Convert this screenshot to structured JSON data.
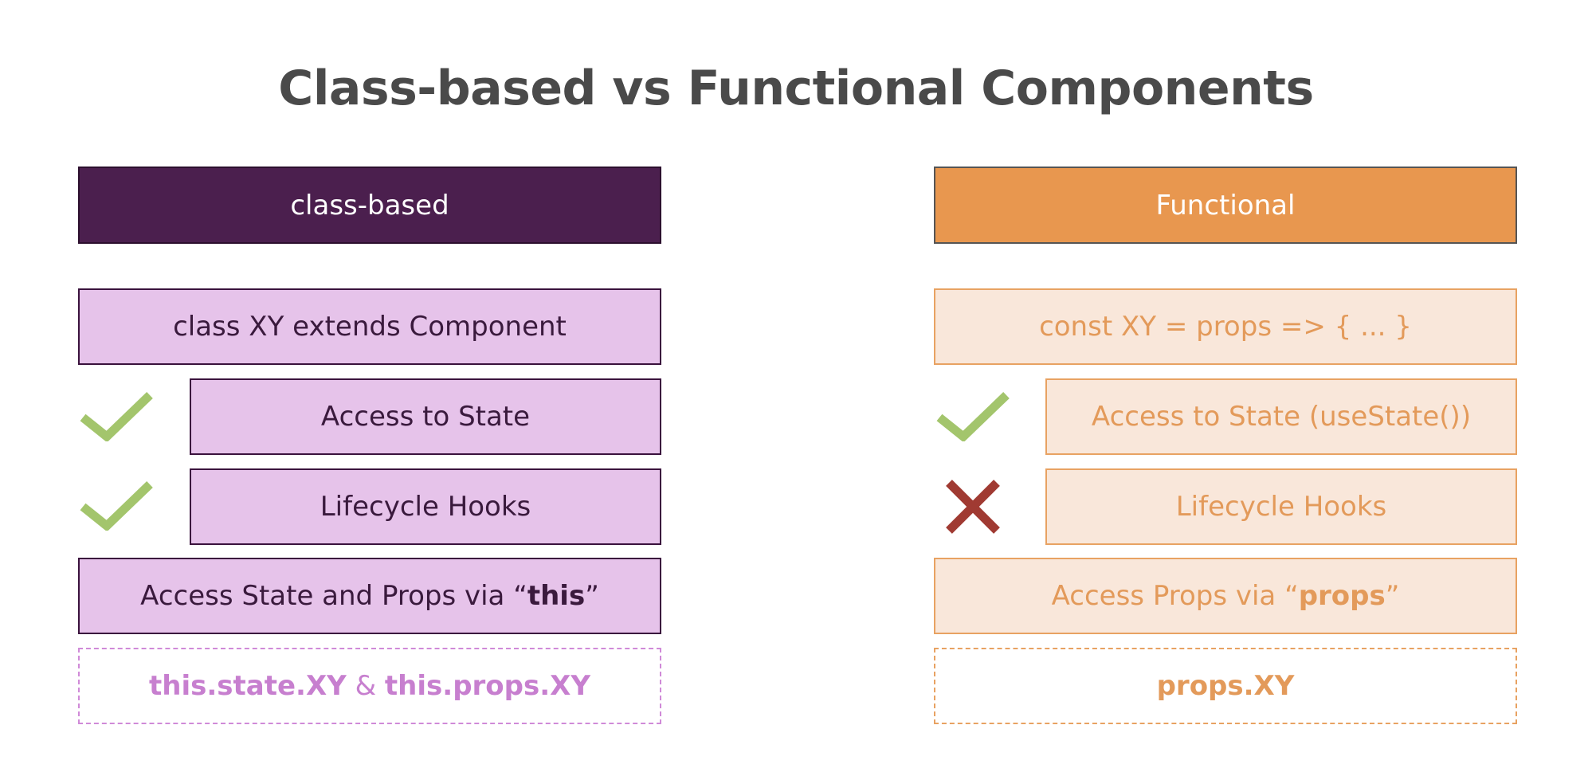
{
  "title": "Class-based vs Functional Components",
  "left": {
    "header": "class-based",
    "definition": "class XY extends Component",
    "rows": [
      {
        "label": "Access to State",
        "mark": "check-icon"
      },
      {
        "label": "Lifecycle Hooks",
        "mark": "check-icon"
      }
    ],
    "access_prefix": "Access State and Props via “",
    "access_keyword": "this",
    "access_suffix": "”",
    "usage_part1": "this.state.XY",
    "usage_amp": " & ",
    "usage_part2": "this.props.XY"
  },
  "right": {
    "header": "Functional",
    "definition": "const XY = props => { ... }",
    "rows": [
      {
        "label": "Access to State (useState())",
        "mark": "check-icon"
      },
      {
        "label": "Lifecycle Hooks",
        "mark": "cross-icon"
      }
    ],
    "access_prefix": "Access Props via “",
    "access_keyword": "props",
    "access_suffix": "”",
    "usage": "props.XY"
  },
  "colors": {
    "class_header": "#4b1f4e",
    "class_box": "#e6c3ea",
    "functional_header": "#e8974f",
    "functional_box": "#f9e7da",
    "check": "#a3c56c",
    "cross": "#a03a32"
  }
}
